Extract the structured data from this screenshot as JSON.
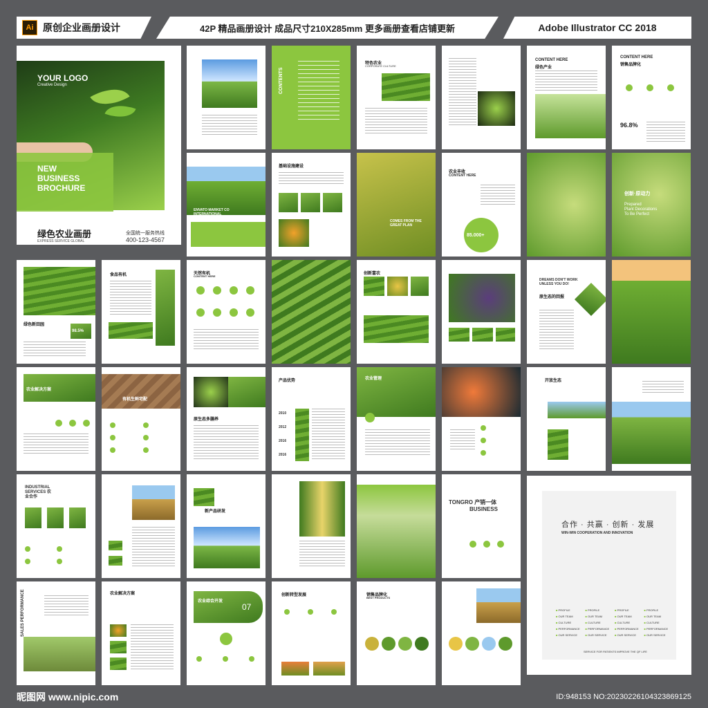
{
  "header": {
    "ai_badge": "Ai",
    "left_title": "原创企业画册设计",
    "center_title": "42P 精品画册设计 成品尺寸210X285mm 更多画册查看店铺更新",
    "right_title": "Adobe Illustrator CC 2018"
  },
  "cover": {
    "logo": "YOUR LOGO",
    "logo_sub": "Creative Design",
    "title_en": "NEW\nBUSINESS\nBROCHURE",
    "title_cn": "绿色农业画册",
    "subtitle_en": "EXPRESS SERVICE GLOBAL",
    "hotline_label": "全国统一服务热线",
    "phone": "400-123-4567"
  },
  "pages": {
    "p_contents": "CONTENTS",
    "p_culture": "特色农业",
    "p_culture_en": "CORPORATE CULTURE",
    "p_green": "绿色产业",
    "p_content_here": "CONTENT HERE",
    "p_sales": "销售品牌化",
    "p_percent": "96.8%",
    "p_infra": "基础设施建设",
    "p_envato": "ENVATO MARKET CO INTERNATIONAL",
    "p_comes": "COMES FROM THE GREAT PLAN",
    "p_harvest": "农业丰收",
    "p_count": "85.000+",
    "p_innov": "创新·原动力",
    "p_prepared": "Prepared\nPlant Decorations\nTo Be Perfect",
    "p_park": "绿色新田园",
    "p_percent2": "98.5%",
    "p_organic": "食品有机",
    "p_natural": "天然有机",
    "p_rich": "创新富农",
    "p_dreams": "DREAMS DON'T WORK UNLESS YOU DO!",
    "p_origin": "原生态的回报",
    "p_solution": "农业解决方案",
    "p_organic2": "有机生鲜宅配",
    "p_eco": "原生态多膳养",
    "p_advantage": "产品优势",
    "p_mgmt": "农业管理",
    "p_open": "开放生态",
    "p_years": [
      "2010",
      "2012",
      "2016",
      "2016"
    ],
    "p_industrial": "INDUSTRIAL SERVICES 农业合作",
    "p_newprod": "新产品研发",
    "p_tongro": "TONGRO 产销一体",
    "p_tongro2": "BUSINESS",
    "p_sales_perf": "SALES PERFORMANCE",
    "p_solution2": "农业解决方案",
    "p_integration": "农业综合开发",
    "p_num07": "07",
    "p_transform": "创新转型发展",
    "p_brand": "销售品牌化",
    "p_brand_en": "BEST PRODUCTS"
  },
  "closing": {
    "title_cn": "合作 · 共赢 · 创新 · 发展",
    "title_en": "WIN-WIN COOPERATION AND INNOVATION",
    "items": [
      "PROFILE",
      "PROFILE",
      "PROFILE",
      "PROFILE",
      "OUR TEAM",
      "OUR TEAM",
      "OUR TEAM",
      "OUR TEAM",
      "CULTURE",
      "CULTURE",
      "CULTURE",
      "CULTURE",
      "PERFORMANCE",
      "PERFORMANCE",
      "PERFORMANCE",
      "PERFORMANCE",
      "OUR SERVICE",
      "OUR SERVICE",
      "OUR SERVICE",
      "OUR SERVICE"
    ],
    "foot": "SERVICE FOR PATIENTS IMPROVE THE QF LIFE"
  },
  "footer": {
    "site": "昵图网 www.nipic.com",
    "id": "ID:948153 NO:20230226104323869125"
  },
  "colors": {
    "accent": "#8cc63f",
    "bg": "#5a5b5e"
  }
}
